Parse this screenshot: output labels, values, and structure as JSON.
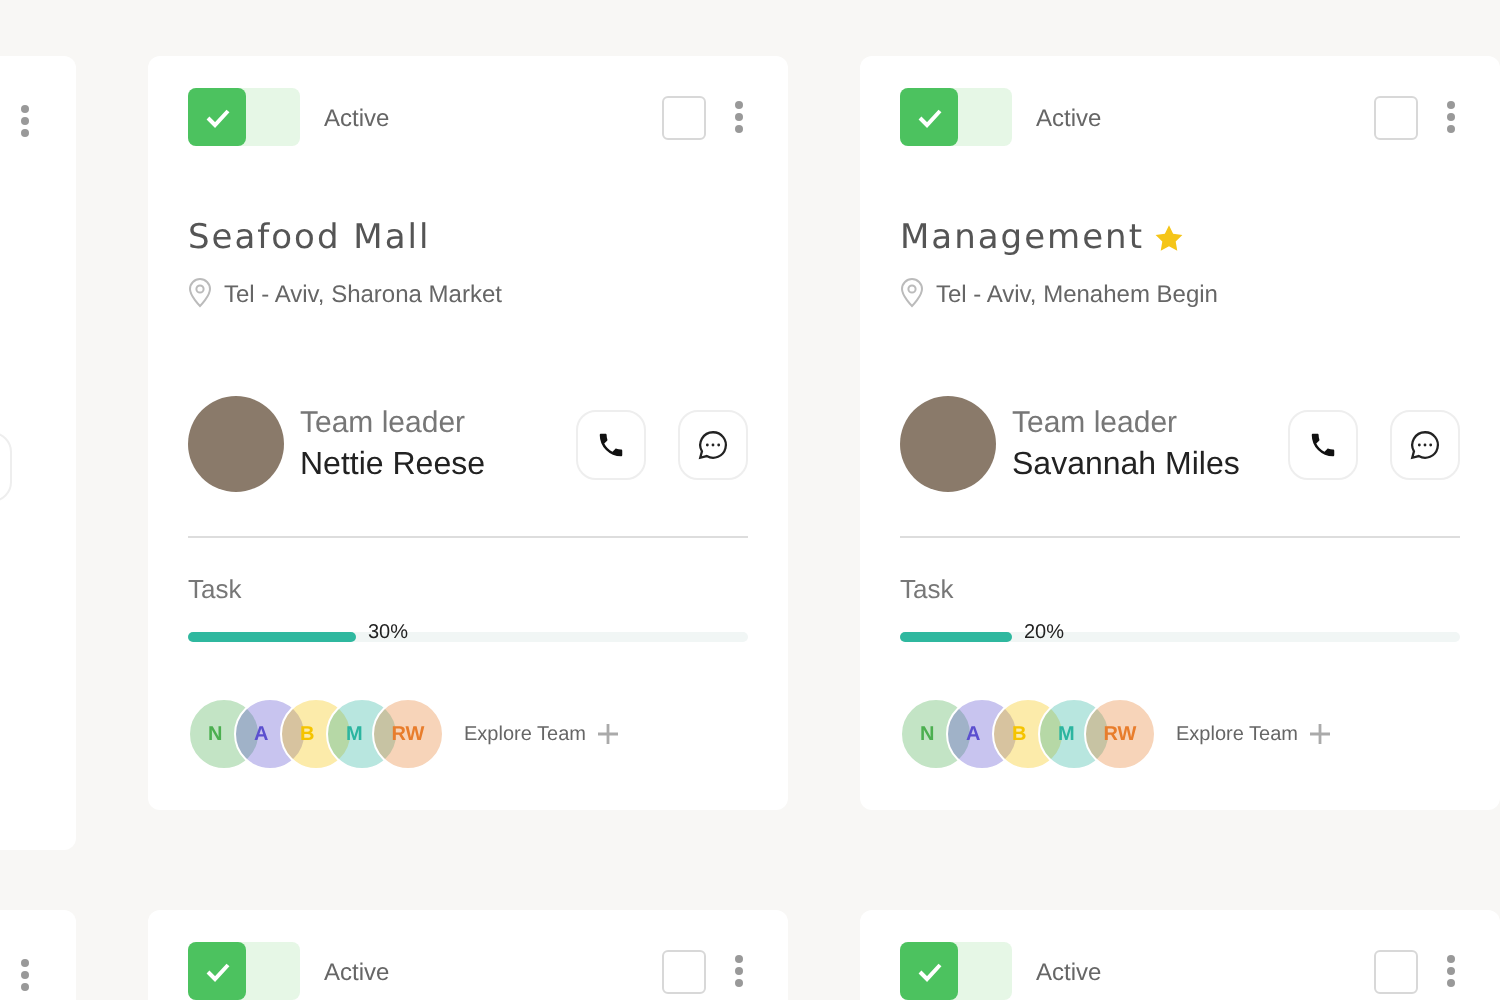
{
  "rows": [
    {
      "cards": [
        {
          "kind": "edge"
        },
        {
          "kind": "full",
          "status": {
            "on": true,
            "label": "Active"
          },
          "checked": false,
          "title": "Seafood Mall",
          "starred": false,
          "location": "Tel - Aviv, Sharona Market",
          "leader": {
            "role": "Team leader",
            "name": "Nettie Reese"
          },
          "task": {
            "label": "Task",
            "level": 0.3,
            "reading": "30%"
          },
          "members": [
            {
              "initials": "N",
              "color": "#4caf50"
            },
            {
              "initials": "A",
              "color": "#5b4fcf"
            },
            {
              "initials": "B",
              "color": "#f5c400"
            },
            {
              "initials": "M",
              "color": "#2bb5a0"
            },
            {
              "initials": "RW",
              "color": "#e87d2c"
            }
          ],
          "explore": "Explore Team"
        },
        {
          "kind": "full",
          "status": {
            "on": true,
            "label": "Active"
          },
          "checked": false,
          "title": "Management",
          "starred": true,
          "location": "Tel - Aviv, Menahem Begin",
          "leader": {
            "role": "Team leader",
            "name": "Savannah Miles"
          },
          "task": {
            "label": "Task",
            "level": 0.2,
            "reading": "20%"
          },
          "members": [
            {
              "initials": "N",
              "color": "#4caf50"
            },
            {
              "initials": "A",
              "color": "#5b4fcf"
            },
            {
              "initials": "B",
              "color": "#f5c400"
            },
            {
              "initials": "M",
              "color": "#2bb5a0"
            },
            {
              "initials": "RW",
              "color": "#e87d2c"
            }
          ],
          "explore": "Explore Team"
        }
      ]
    },
    {
      "cards": [
        {
          "kind": "edge"
        },
        {
          "kind": "header",
          "status": {
            "on": true,
            "label": "Active"
          },
          "checked": false
        },
        {
          "kind": "header",
          "status": {
            "on": true,
            "label": "Active"
          },
          "checked": false
        }
      ]
    }
  ]
}
